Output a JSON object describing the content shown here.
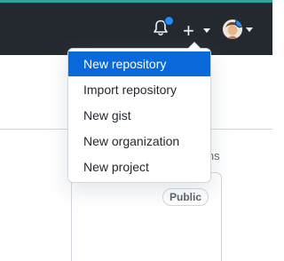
{
  "header": {
    "notifications_icon": "bell-icon",
    "create_icon": "plus-icon",
    "create_glyph": "+",
    "avatar_icon": "user-avatar"
  },
  "menu": {
    "items": [
      {
        "label": "New repository",
        "active": true
      },
      {
        "label": "Import repository",
        "active": false
      },
      {
        "label": "New gist",
        "active": false
      },
      {
        "label": "New organization",
        "active": false
      },
      {
        "label": "New project",
        "active": false
      }
    ]
  },
  "page": {
    "side_text": "ins",
    "visibility_badge": "Public"
  },
  "colors": {
    "header_bg": "#24292f",
    "active_item_bg": "#0969da",
    "notification_dot": "#218bff",
    "accent_line": "#2da39a"
  }
}
